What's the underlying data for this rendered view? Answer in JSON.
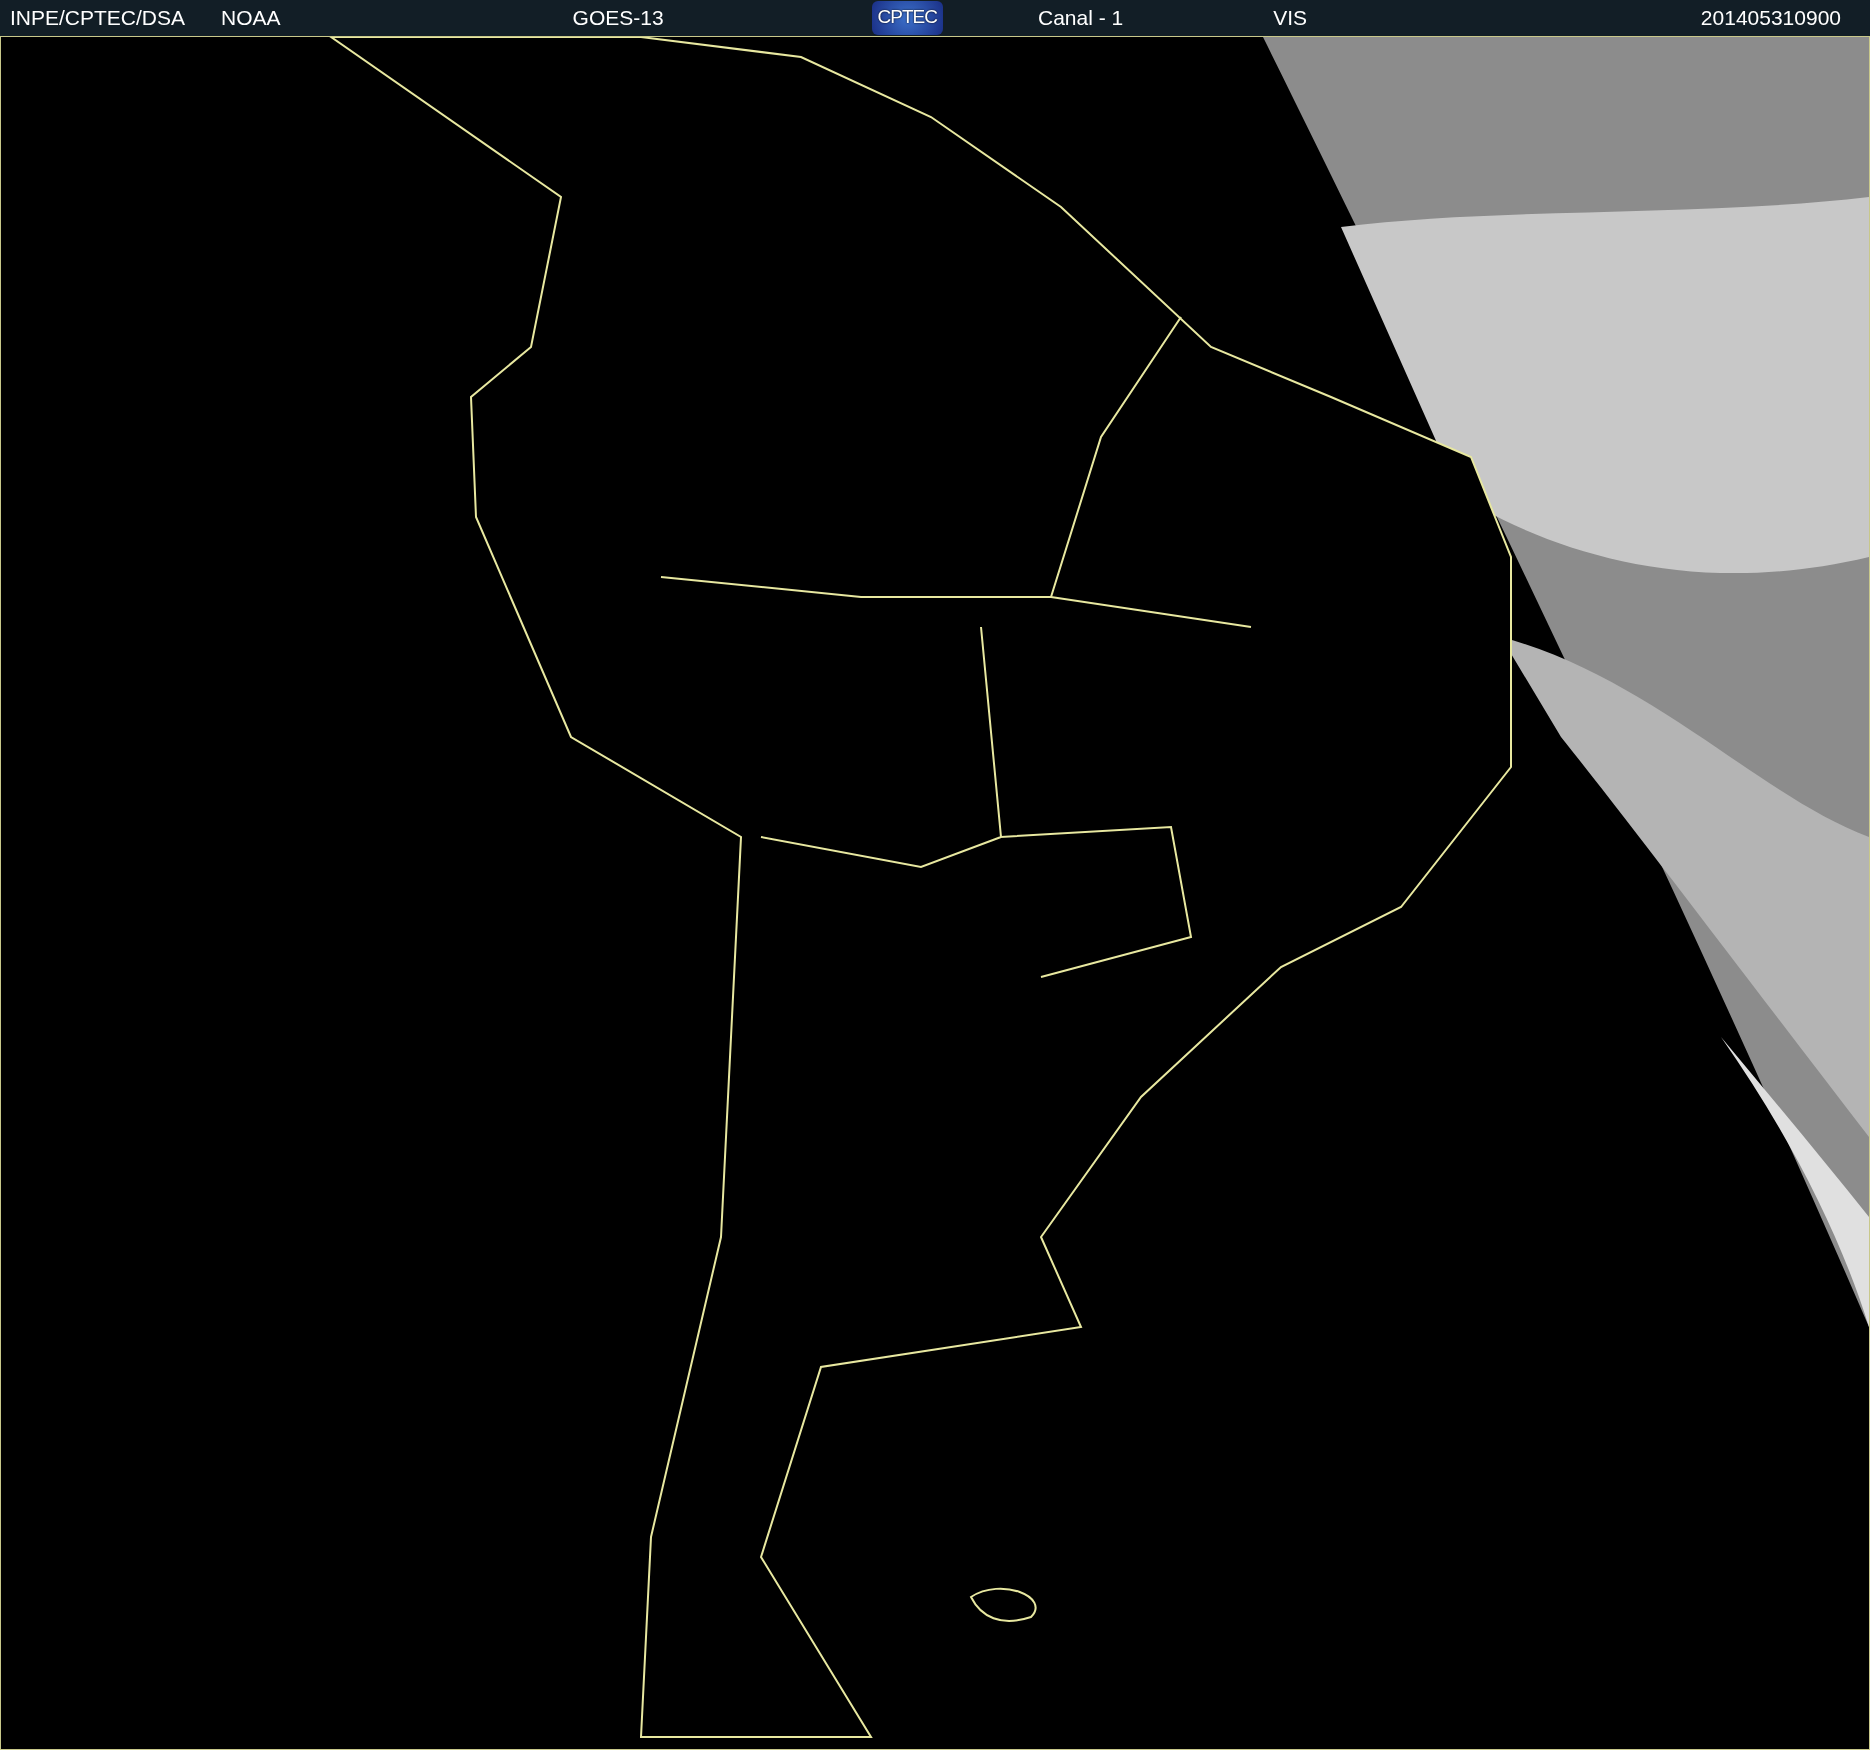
{
  "header": {
    "source": "INPE/CPTEC/DSA",
    "agency": "NOAA",
    "satellite": "GOES-13",
    "logo": "CPTEC",
    "channel": "Canal - 1",
    "band": "VIS",
    "timestamp": "201405310900"
  }
}
